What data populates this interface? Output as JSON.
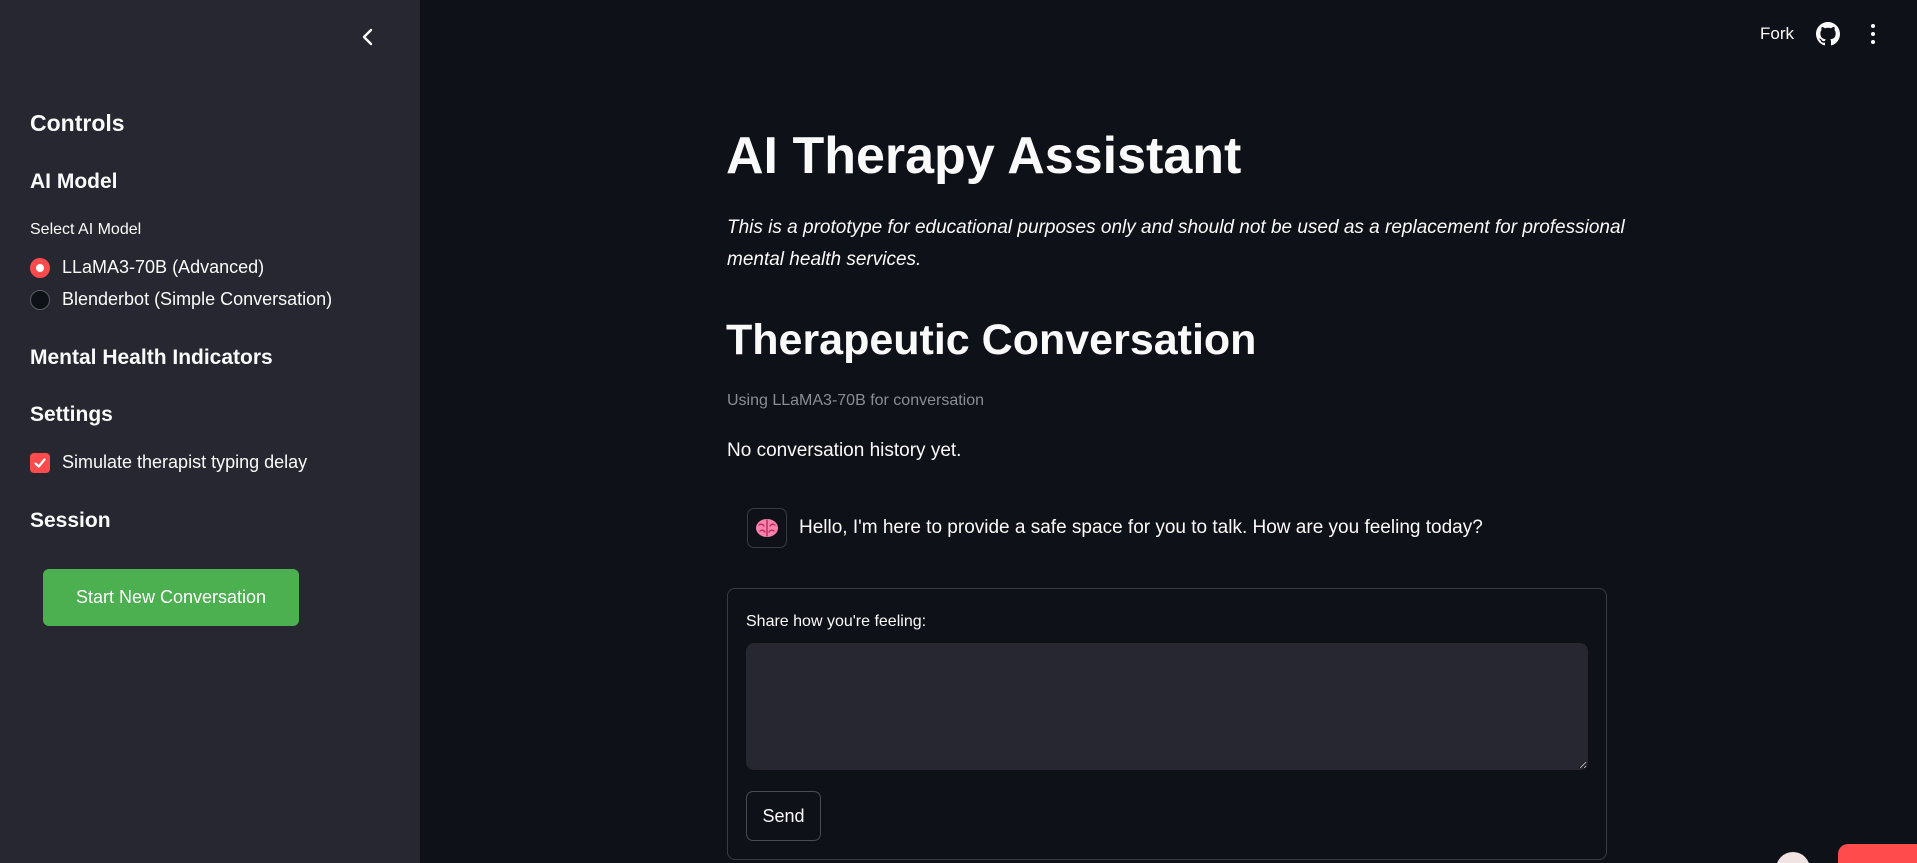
{
  "sidebar": {
    "controls_heading": "Controls",
    "ai_model_heading": "AI Model",
    "select_label": "Select AI Model",
    "model_options": [
      {
        "label": "LLaMA3-70B (Advanced)",
        "selected": true
      },
      {
        "label": "Blenderbot (Simple Conversation)",
        "selected": false
      }
    ],
    "mental_health_heading": "Mental Health Indicators",
    "settings_heading": "Settings",
    "typing_delay_label": "Simulate therapist typing delay",
    "typing_delay_checked": true,
    "session_heading": "Session",
    "start_button_label": "Start New Conversation"
  },
  "header": {
    "fork_label": "Fork"
  },
  "main": {
    "title": "AI Therapy Assistant",
    "disclaimer": "This is a prototype for educational purposes only and should not be used as a replacement for professional mental health services.",
    "conversation_heading": "Therapeutic Conversation",
    "model_caption": "Using LLaMA3-70B for conversation",
    "no_history_text": "No conversation history yet.",
    "assistant_message": "Hello, I'm here to provide a safe space for you to talk. How are you feeling today?",
    "input_label": "Share how you're feeling:",
    "input_value": "",
    "send_label": "Send"
  },
  "colors": {
    "background": "#0e1117",
    "sidebar": "#262730",
    "accent": "#ff4b4b",
    "start_button": "#4caf50",
    "text": "#fafafa",
    "muted": "#8b8d94"
  },
  "icons": [
    "chevron-left-icon",
    "github-icon",
    "more-vertical-icon",
    "brain-icon"
  ]
}
